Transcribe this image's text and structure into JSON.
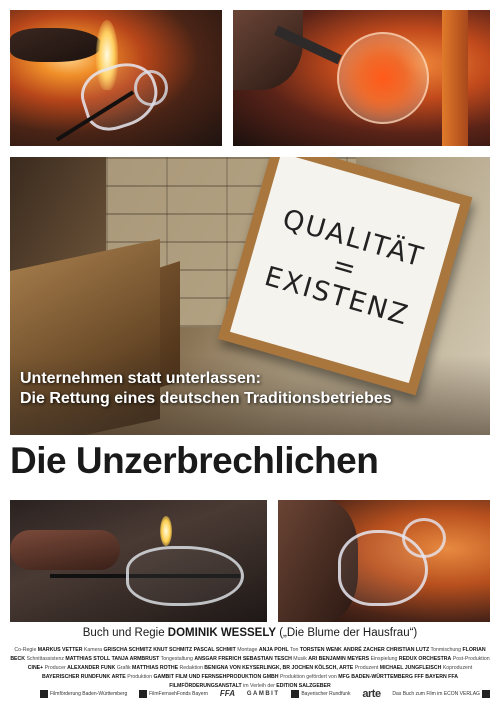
{
  "photos": {
    "top_left": "glassblower heating glass vessel",
    "top_right": "glass orb on blowpipe",
    "center": "workshop wall with sign",
    "bottom_left": "glass vessel being shaped",
    "bottom_right": "finished glass jug"
  },
  "sign": {
    "line1": "QUALITÄT",
    "line2": "=",
    "line3": "EXISTENZ"
  },
  "tagline": {
    "line1": "Unternehmen statt unterlassen:",
    "line2": "Die Rettung eines deutschen Traditionsbetriebes"
  },
  "title": "Die Unzerbrechlichen",
  "director_line": {
    "prefix": "Buch und Regie",
    "name": "DOMINIK WESSELY",
    "suffix": "(„Die Blume der Hausfrau“)"
  },
  "credits": [
    {
      "label": "Co-Regie",
      "name": "MARKUS VETTER"
    },
    {
      "label": "Kamera",
      "name": "GRISCHA SCHMITZ"
    },
    {
      "label": "",
      "name": "KNUT SCHMITZ"
    },
    {
      "label": "",
      "name": "PASCAL SCHMIT"
    },
    {
      "label": "Montage",
      "name": "ANJA POHL"
    },
    {
      "label": "Ton",
      "name": "TORSTEN WENK"
    },
    {
      "label": "",
      "name": "ANDRÉ ZACHER"
    },
    {
      "label": "",
      "name": "CHRISTIAN LUTZ"
    },
    {
      "label": "Tonmischung",
      "name": "FLORIAN BECK"
    },
    {
      "label": "Schnittassistenz",
      "name": "MATTHIAS STOLL"
    },
    {
      "label": "",
      "name": "TANJA ARMBRUST"
    },
    {
      "label": "Tongestaltung",
      "name": "ANSGAR FRERICH"
    },
    {
      "label": "",
      "name": "SEBASTIAN TESCH"
    },
    {
      "label": "Musik",
      "name": "ARI BENJAMIN MEYERS"
    },
    {
      "label": "Einspielung",
      "name": "REDUX ORCHESTRA"
    },
    {
      "label": "Post-Produktion",
      "name": "CINE+"
    },
    {
      "label": "Producer",
      "name": "ALEXANDER FUNK"
    },
    {
      "label": "Grafik",
      "name": "MATTHIAS ROTHE"
    },
    {
      "label": "Redaktion",
      "name": "BENIGNA VON KEYSERLINGK, BR"
    },
    {
      "label": "",
      "name": "JOCHEN KÖLSCH, ARTE"
    },
    {
      "label": "Produzent",
      "name": "MICHAEL JUNGFLEISCH"
    },
    {
      "label": "Koproduzent",
      "name": "BAYERISCHER RUNDFUNK"
    },
    {
      "label": "",
      "name": "ARTE"
    },
    {
      "label": "Produktion",
      "name": "GAMBIT FILM UND FERNSEHPRODUKTION GMBH"
    },
    {
      "label": "Produktion gefördert von",
      "name": "MFG BADEN-WÜRTTEMBERG"
    },
    {
      "label": "",
      "name": "FFF BAYERN"
    },
    {
      "label": "",
      "name": "FFA FILMFÖRDERUNGSANSTALT"
    },
    {
      "label": "im Verleih der",
      "name": "EDITION SALZGEBER"
    }
  ],
  "logos": [
    {
      "id": "mfg",
      "text": "Filmförderung Baden-Württemberg"
    },
    {
      "id": "fff",
      "text": "FilmFernsehFonds Bayern"
    },
    {
      "id": "ffa",
      "text": "FFA"
    },
    {
      "id": "gambit",
      "text": "GAMBIT"
    },
    {
      "id": "br",
      "text": "Bayerischer Rundfunk"
    },
    {
      "id": "arte",
      "text": "arte"
    },
    {
      "id": "book",
      "text": "Das Buch zum Film im ECON VERLAG"
    }
  ],
  "colors": {
    "title": "#1a1a1a",
    "tagline": "#ffffff",
    "background": "#ffffff"
  }
}
